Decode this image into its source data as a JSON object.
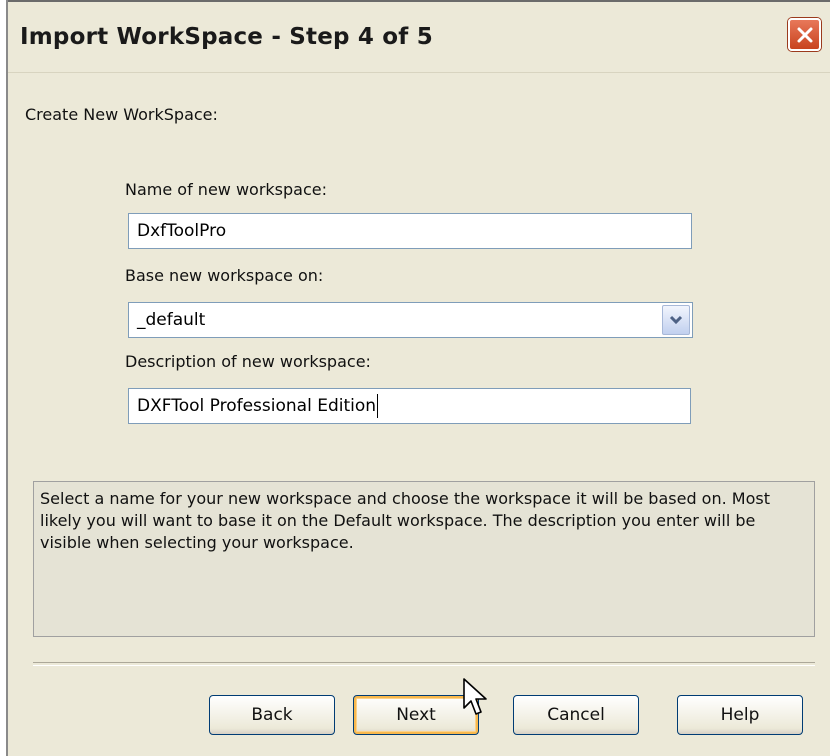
{
  "window": {
    "title": "Import WorkSpace - Step 4 of 5"
  },
  "form": {
    "section_heading": "Create New WorkSpace:",
    "name_label": "Name of new workspace:",
    "name_value": "DxfToolPro",
    "base_label": "Base new workspace on:",
    "base_value": "_default",
    "description_label": "Description of new workspace:",
    "description_value": "DXFTool Professional Edition"
  },
  "help": {
    "text": "Select a name for your new workspace and choose the workspace it will be based on. Most likely you will want to base it on the Default workspace. The description you enter will be visible when selecting your workspace."
  },
  "buttons": {
    "back": "Back",
    "next": "Next",
    "cancel": "Cancel",
    "help": "Help"
  },
  "icons": {
    "close": "close-icon",
    "dropdown": "chevron-down-icon",
    "cursor": "mouse-pointer-icon"
  },
  "colors": {
    "close_button": "#d2542c",
    "default_button_focus": "#f8b84d",
    "window_background": "#ece9d8"
  }
}
